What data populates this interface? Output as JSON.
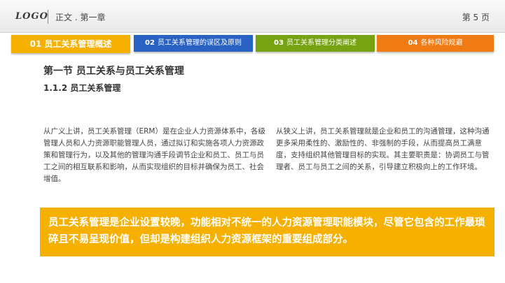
{
  "header": {
    "logo": "LOGO",
    "chapter": "正文 . 第一章",
    "page": "第 5 页"
  },
  "tabs": [
    {
      "num": "01",
      "label": "员工关系管理概述"
    },
    {
      "num": "02",
      "label": "员工关系管理的误区及原则"
    },
    {
      "num": "03",
      "label": "员工关系管理分类阐述"
    },
    {
      "num": "04",
      "label": "各种风险规避"
    }
  ],
  "content": {
    "section_title": "第一节 员工关系与员工关系管理",
    "sub_title": "1.1.2 员工关系管理",
    "left_paragraph": "从广义上讲，员工关系管理（ERM）是在企业人力资源体系中，各级管理人员和人力资源职能管理人员，通过拟订和实施各项人力资源政策和管理行为，以及其他的管理沟通手段调节企业和员工、员工与员工之间的相互联系和影响，从而实现组织的目标并确保为员工、社会增值。",
    "right_paragraph": "从狭义上讲，员工关系管理就是企业和员工的沟通管理，这种沟通更多采用柔性的、激励性的、非强制的手段，从而提高员工满意度，支持组织其他管理目标的实现。其主要职责是：协调员工与管理者、员工与员工之间的关系，引导建立积极向上的工作环境。",
    "highlight": "员工关系管理是企业设置较晚，功能相对不统一的人力资源管理职能模块，尽管它包含的工作最琐碎且不易呈现价值，但却是构建组织人力资源框架的重要组成部分。"
  },
  "colors": {
    "tab1": "#f6b000",
    "tab2": "#2a62c4",
    "tab3": "#77a312",
    "tab4": "#f07b14",
    "highlight": "#f6b000"
  }
}
